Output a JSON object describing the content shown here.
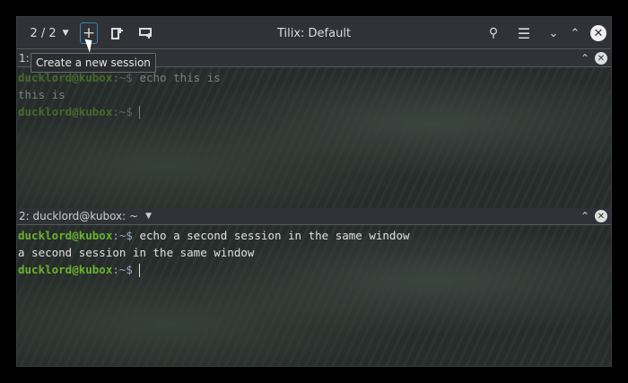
{
  "header": {
    "session_counter": "2 / 2",
    "title": "Tilix: Default",
    "new_session_tooltip": "Create a new session"
  },
  "panes": [
    {
      "title": "1:",
      "lines": [
        {
          "prompt": "ducklord@kubox",
          "path": ":~$ ",
          "cmd": "echo this is"
        },
        {
          "output": "this is"
        },
        {
          "prompt": "ducklord@kubox",
          "path": ":~$ ",
          "cmd": ""
        }
      ]
    },
    {
      "title": "2: ducklord@kubox: ~",
      "lines": [
        {
          "prompt": "ducklord@kubox",
          "path": ":~$ ",
          "cmd": "echo a second session in the same window"
        },
        {
          "output": "a second session in the same window"
        },
        {
          "prompt": "ducklord@kubox",
          "path": ":~$ ",
          "cmd": ""
        }
      ]
    }
  ],
  "colors": {
    "prompt": "#6bb32e",
    "accent": "#3b84b5"
  }
}
